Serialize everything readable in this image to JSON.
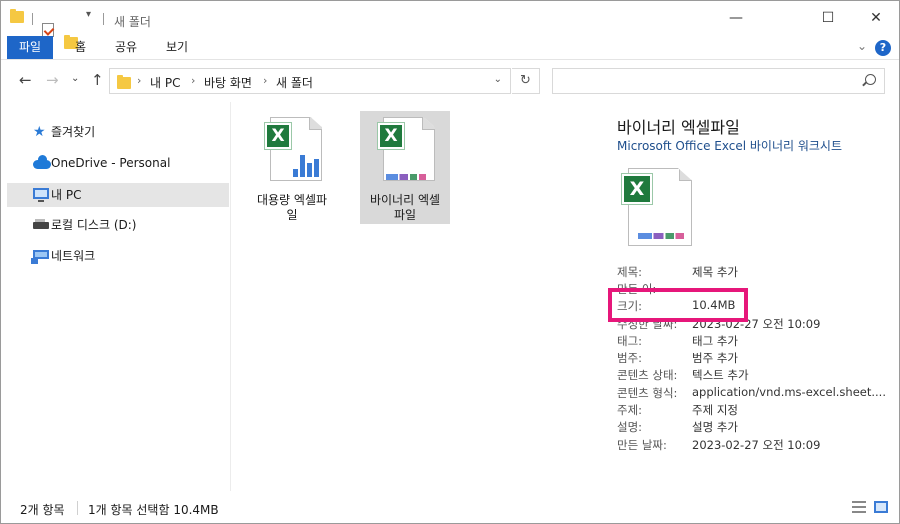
{
  "titlebar": {
    "title": "새 폴더",
    "minimize": "—",
    "maximize": "☐",
    "close": "✕"
  },
  "ribbon": {
    "tabs": [
      "파일",
      "홈",
      "공유",
      "보기"
    ],
    "collapse": "⌄",
    "help": "?"
  },
  "nav": {
    "back": "←",
    "forward": "→",
    "recent": "⌄",
    "up": "↑",
    "refresh": "↻"
  },
  "address": {
    "crumbs": [
      "내 PC",
      "바탕 화면",
      "새 폴더"
    ],
    "chevron": "›",
    "dropdown": "⌄"
  },
  "search": {
    "placeholder": ""
  },
  "sidebar": {
    "items": [
      {
        "label": "즐겨찾기",
        "icon": "star-icon"
      },
      {
        "label": "OneDrive - Personal",
        "icon": "cloud-icon"
      },
      {
        "label": "내 PC",
        "icon": "computer-icon"
      },
      {
        "label": "로컬 디스크 (D:)",
        "icon": "drive-icon"
      },
      {
        "label": "네트워크",
        "icon": "network-icon"
      }
    ],
    "selected": "내 PC"
  },
  "files": [
    {
      "name_line1": "대용량 엑셀파",
      "name_line2": "일",
      "icon": "excel-chart-file-icon"
    },
    {
      "name_line1": "바이너리 엑셀",
      "name_line2": "파일",
      "icon": "excel-binary-file-icon",
      "selected": true
    }
  ],
  "details": {
    "title": "바이너리 엑셀파일",
    "type": "Microsoft Office Excel 바이너리 워크시트",
    "props": [
      {
        "k": "제목:",
        "v": "제목 추가"
      },
      {
        "k": "만든 이:",
        "v": ""
      },
      {
        "k": "크기:",
        "v": "10.4MB"
      },
      {
        "k": "수정한 날짜:",
        "v": "2023-02-27 오전 10:09"
      },
      {
        "k": "태그:",
        "v": "태그 추가"
      },
      {
        "k": "범주:",
        "v": "범주 추가"
      },
      {
        "k": "콘텐츠 상태:",
        "v": "텍스트 추가"
      },
      {
        "k": "콘텐츠 형식:",
        "v": "application/vnd.ms-excel.sheet...."
      },
      {
        "k": "주제:",
        "v": "주제 지정"
      },
      {
        "k": "설명:",
        "v": "설명 추가"
      },
      {
        "k": "만든 날짜:",
        "v": "2023-02-27 오전 10:09"
      }
    ],
    "highlight_color": "#e6177a"
  },
  "status": {
    "count": "2개 항목",
    "selection": "1개 항목 선택함 10.4MB"
  },
  "colors": {
    "accent": "#1e66c8",
    "excel_green": "#1f7a3d",
    "folder": "#f5c842"
  }
}
